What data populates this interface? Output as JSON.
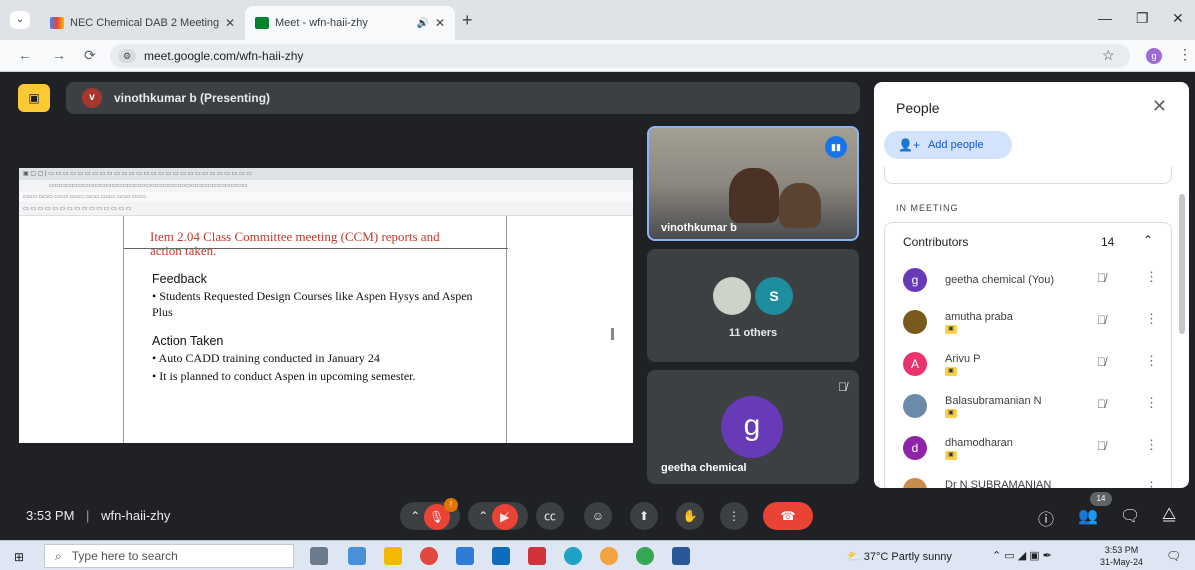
{
  "browser": {
    "tabs": [
      {
        "title": "NEC Chemical DAB 2 Meeting c",
        "active": false
      },
      {
        "title": "Meet - wfn-haii-zhy",
        "active": true
      }
    ],
    "url": "meet.google.com/wfn-haii-zhy",
    "profile_initial": "g"
  },
  "meet": {
    "presenter_initial": "v",
    "presenter_label": "vinothkumar b (Presenting)",
    "shared_screen": {
      "heading_line1": "Item 2.04 Class Committee meeting (CCM) reports and",
      "heading_line2": "action taken.",
      "feedback_title": "Feedback",
      "feedback_bullet": "•  Students Requested Design Courses like  Aspen Hysys and Aspen Plus",
      "action_title": "Action Taken",
      "action_bullet1": "•  Auto CADD training conducted in January 24",
      "action_bullet2": "•  It is planned to conduct Aspen in upcoming semester."
    },
    "tiles": {
      "camera_name": "vinothkumar b",
      "others_initial": "S",
      "others_label": "11 others",
      "self_initial": "g",
      "self_name": "geetha chemical"
    }
  },
  "people_panel": {
    "title": "People",
    "add_people": "Add people",
    "in_meeting": "IN MEETING",
    "contributors_label": "Contributors",
    "contributors_count": "14",
    "participants": [
      {
        "initial": "g",
        "name": "geetha chemical (You)",
        "color": "#673ab7",
        "badge": false
      },
      {
        "initial": "",
        "name": "amutha praba",
        "color": "#7a5a1c",
        "badge": true
      },
      {
        "initial": "A",
        "name": "Arivu P",
        "color": "#e8336d",
        "badge": true
      },
      {
        "initial": "",
        "name": "Balasubramanian N",
        "color": "#6c8ba8",
        "badge": true
      },
      {
        "initial": "d",
        "name": "dhamodharan",
        "color": "#8e24aa",
        "badge": true
      },
      {
        "initial": "",
        "name": "Dr N SUBRAMANIAN",
        "color": "#c98b4a",
        "badge": false
      }
    ]
  },
  "controls": {
    "time": "3:53 PM",
    "meeting_code": "wfn-haii-zhy",
    "notification_count": "!",
    "people_count": "14"
  },
  "taskbar": {
    "search_placeholder": "Type here to search",
    "weather": "37°C  Partly sunny",
    "time": "3:53 PM",
    "date": "31-May-24"
  }
}
